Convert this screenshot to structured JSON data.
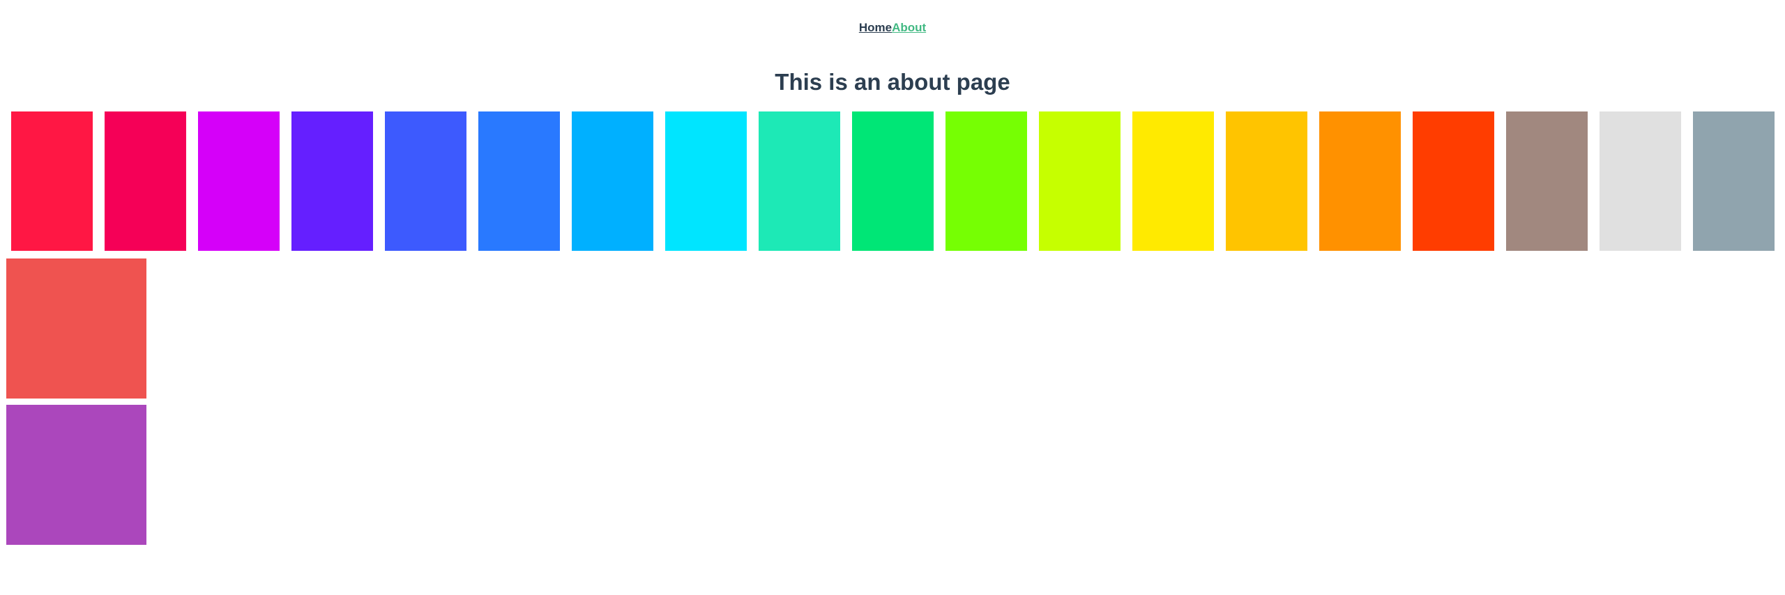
{
  "nav": {
    "home_label": "Home",
    "about_label": "About"
  },
  "page": {
    "title": "This is an about page"
  },
  "swatches": [
    {
      "color": "#ff1744"
    },
    {
      "color": "#f50057"
    },
    {
      "color": "#d500f9"
    },
    {
      "color": "#651fff"
    },
    {
      "color": "#3d5afe"
    },
    {
      "color": "#2979ff"
    },
    {
      "color": "#00b0ff"
    },
    {
      "color": "#00e5ff"
    },
    {
      "color": "#1de9b6"
    },
    {
      "color": "#00e676"
    },
    {
      "color": "#76ff03"
    },
    {
      "color": "#c6ff00"
    },
    {
      "color": "#ffea00"
    },
    {
      "color": "#ffc400"
    },
    {
      "color": "#ff9100"
    },
    {
      "color": "#ff3d00"
    },
    {
      "color": "#a1887f"
    },
    {
      "color": "#e0e0e0"
    },
    {
      "color": "#90a4ae"
    }
  ],
  "blocks": [
    {
      "color": "#ef5350"
    },
    {
      "color": "#ab47bc"
    }
  ]
}
